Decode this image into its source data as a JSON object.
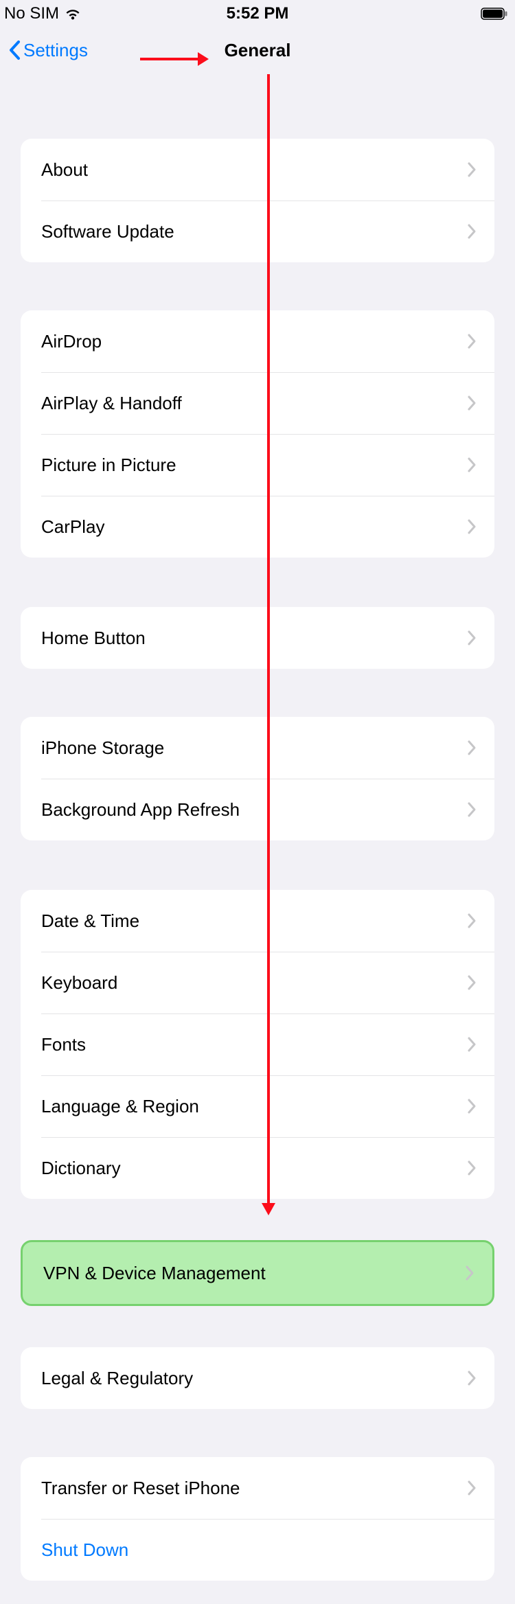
{
  "status_bar": {
    "carrier": "No SIM",
    "time": "5:52 PM"
  },
  "nav": {
    "back_label": "Settings",
    "title": "General"
  },
  "groups": [
    {
      "spacer_before": 96,
      "highlight": false,
      "rows": [
        {
          "key": "about",
          "label": "About",
          "chevron": true,
          "blue": false
        },
        {
          "key": "software-update",
          "label": "Software Update",
          "chevron": true,
          "blue": false
        }
      ]
    },
    {
      "spacer_before": 70,
      "highlight": false,
      "rows": [
        {
          "key": "airdrop",
          "label": "AirDrop",
          "chevron": true,
          "blue": false
        },
        {
          "key": "airplay-handoff",
          "label": "AirPlay & Handoff",
          "chevron": true,
          "blue": false
        },
        {
          "key": "picture-in-picture",
          "label": "Picture in Picture",
          "chevron": true,
          "blue": false
        },
        {
          "key": "carplay",
          "label": "CarPlay",
          "chevron": true,
          "blue": false
        }
      ]
    },
    {
      "spacer_before": 72,
      "highlight": false,
      "rows": [
        {
          "key": "home-button",
          "label": "Home Button",
          "chevron": true,
          "blue": false
        }
      ]
    },
    {
      "spacer_before": 70,
      "highlight": false,
      "rows": [
        {
          "key": "iphone-storage",
          "label": "iPhone Storage",
          "chevron": true,
          "blue": false
        },
        {
          "key": "background-app-refresh",
          "label": "Background App Refresh",
          "chevron": true,
          "blue": false
        }
      ]
    },
    {
      "spacer_before": 72,
      "highlight": false,
      "rows": [
        {
          "key": "date-time",
          "label": "Date & Time",
          "chevron": true,
          "blue": false
        },
        {
          "key": "keyboard",
          "label": "Keyboard",
          "chevron": true,
          "blue": false
        },
        {
          "key": "fonts",
          "label": "Fonts",
          "chevron": true,
          "blue": false
        },
        {
          "key": "language-region",
          "label": "Language & Region",
          "chevron": true,
          "blue": false
        },
        {
          "key": "dictionary",
          "label": "Dictionary",
          "chevron": true,
          "blue": false
        }
      ]
    },
    {
      "spacer_before": 60,
      "highlight": true,
      "rows": [
        {
          "key": "vpn-device-management",
          "label": "VPN & Device Management",
          "chevron": true,
          "blue": false
        }
      ]
    },
    {
      "spacer_before": 60,
      "highlight": false,
      "rows": [
        {
          "key": "legal-regulatory",
          "label": "Legal & Regulatory",
          "chevron": true,
          "blue": false
        }
      ]
    },
    {
      "spacer_before": 70,
      "highlight": false,
      "rows": [
        {
          "key": "transfer-reset",
          "label": "Transfer or Reset iPhone",
          "chevron": true,
          "blue": false
        },
        {
          "key": "shut-down",
          "label": "Shut Down",
          "chevron": false,
          "blue": true
        }
      ]
    }
  ]
}
